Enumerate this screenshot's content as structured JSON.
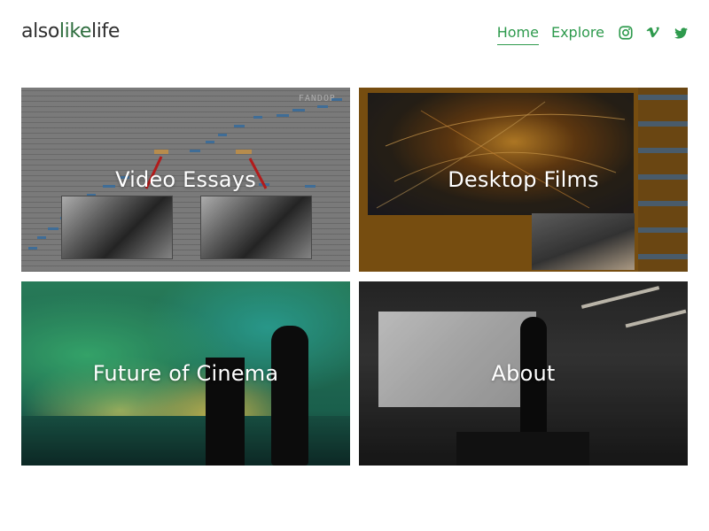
{
  "brand": {
    "logo_part1": "also",
    "logo_part2": "like",
    "logo_part3": "life"
  },
  "nav": {
    "items": [
      {
        "label": "Home",
        "active": true
      },
      {
        "label": "Explore",
        "active": false
      }
    ],
    "social": [
      "instagram-icon",
      "vimeo-icon",
      "twitter-icon"
    ],
    "accent_color": "#2e9a4d"
  },
  "tiles": [
    {
      "title": "Video Essays",
      "fandor_text": "FANDOR"
    },
    {
      "title": "Desktop Films"
    },
    {
      "title": "Future of Cinema"
    },
    {
      "title": "About"
    }
  ]
}
